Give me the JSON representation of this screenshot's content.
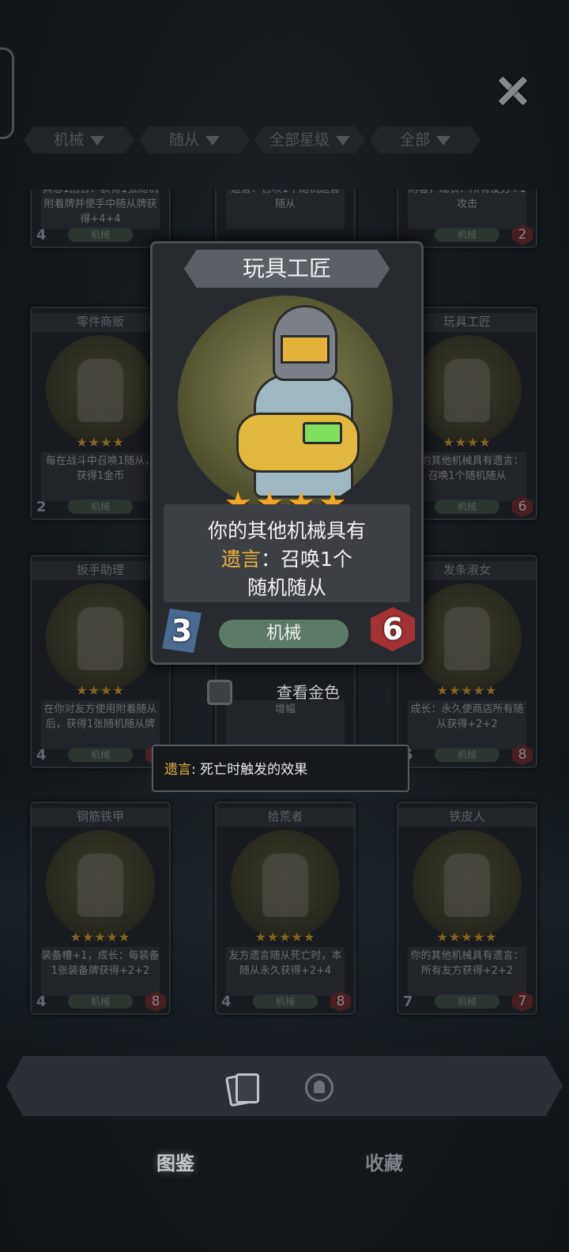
{
  "filters": [
    {
      "label": "机械"
    },
    {
      "label": "随从"
    },
    {
      "label": "全部星级"
    },
    {
      "label": "全部"
    }
  ],
  "cards": [
    {
      "name": "",
      "desc": "冥想1回合：获得1张随机附着牌并使手中随从牌获得+4+4",
      "tag": "机械",
      "cost": "4",
      "hp": "",
      "stars": "★★★★"
    },
    {
      "name": "",
      "desc": "遗言：召唤1个随机遗言随从",
      "tag": "",
      "cost": "",
      "hp": "",
      "stars": "★★★★"
    },
    {
      "name": "",
      "desc": "附着，成长：所有友方+1攻击",
      "tag": "机械",
      "cost": "",
      "hp": "2",
      "stars": "★★★★"
    },
    {
      "name": "零件商贩",
      "desc": "每在战斗中召唤1随从，获得1金币",
      "tag": "机械",
      "cost": "2",
      "hp": "",
      "stars": "★★★★"
    },
    {
      "name": "玩具工匠",
      "desc": "你的其他机械具有遗言：召唤1个随机随从",
      "tag": "机械",
      "cost": "",
      "hp": "6",
      "stars": "★★★★"
    },
    {
      "name": "扳手助理",
      "desc": "在你对友方使用附着随从后，获得1张随机随从牌",
      "tag": "机械",
      "cost": "4",
      "hp": "6",
      "stars": "★★★★"
    },
    {
      "name": "",
      "desc": "增幅",
      "tag": "",
      "cost": "",
      "hp": "",
      "stars": ""
    },
    {
      "name": "发条淑女",
      "desc": "成长：永久使商店所有随从获得+2+2",
      "tag": "机械",
      "cost": "5",
      "hp": "8",
      "stars": "★★★★★"
    },
    {
      "name": "钢筋铁甲",
      "desc": "装备槽+1，成长：每装备1张装备牌获得+2+2",
      "tag": "机械",
      "cost": "4",
      "hp": "8",
      "stars": "★★★★★"
    },
    {
      "name": "拾荒者",
      "desc": "友方遗言随从死亡时，本随从永久获得+2+4",
      "tag": "机械",
      "cost": "4",
      "hp": "8",
      "stars": "★★★★★"
    },
    {
      "name": "铁皮人",
      "desc": "你的其他机械具有遗言：所有友方获得+2+2",
      "tag": "机械",
      "cost": "7",
      "hp": "7",
      "stars": "★★★★★"
    }
  ],
  "popup": {
    "name": "玩具工匠",
    "stars": "★★★★",
    "desc_line1": "你的其他机械具有",
    "desc_kw": "遗言",
    "desc_line2_rest": "：召唤1个",
    "desc_line3": "随机随从",
    "cost": "3",
    "tag": "机械",
    "hp": "6"
  },
  "gold_toggle": {
    "label": "查看金色",
    "checked": false
  },
  "tooltip": {
    "kw": "遗言",
    "text": ": 死亡时触发的效果"
  },
  "bottom_nav": {
    "tab1": "图鉴",
    "tab2": "收藏",
    "active": "图鉴"
  },
  "icons": [
    "close-icon",
    "filter-dropdown-icon",
    "cards-icon",
    "collection-icon"
  ],
  "colors": {
    "keyword": "#e9b43e",
    "star": "#f0a62a",
    "cost": "#4a6a8f",
    "hp": "#a33232",
    "tag": "#5c7a66"
  }
}
